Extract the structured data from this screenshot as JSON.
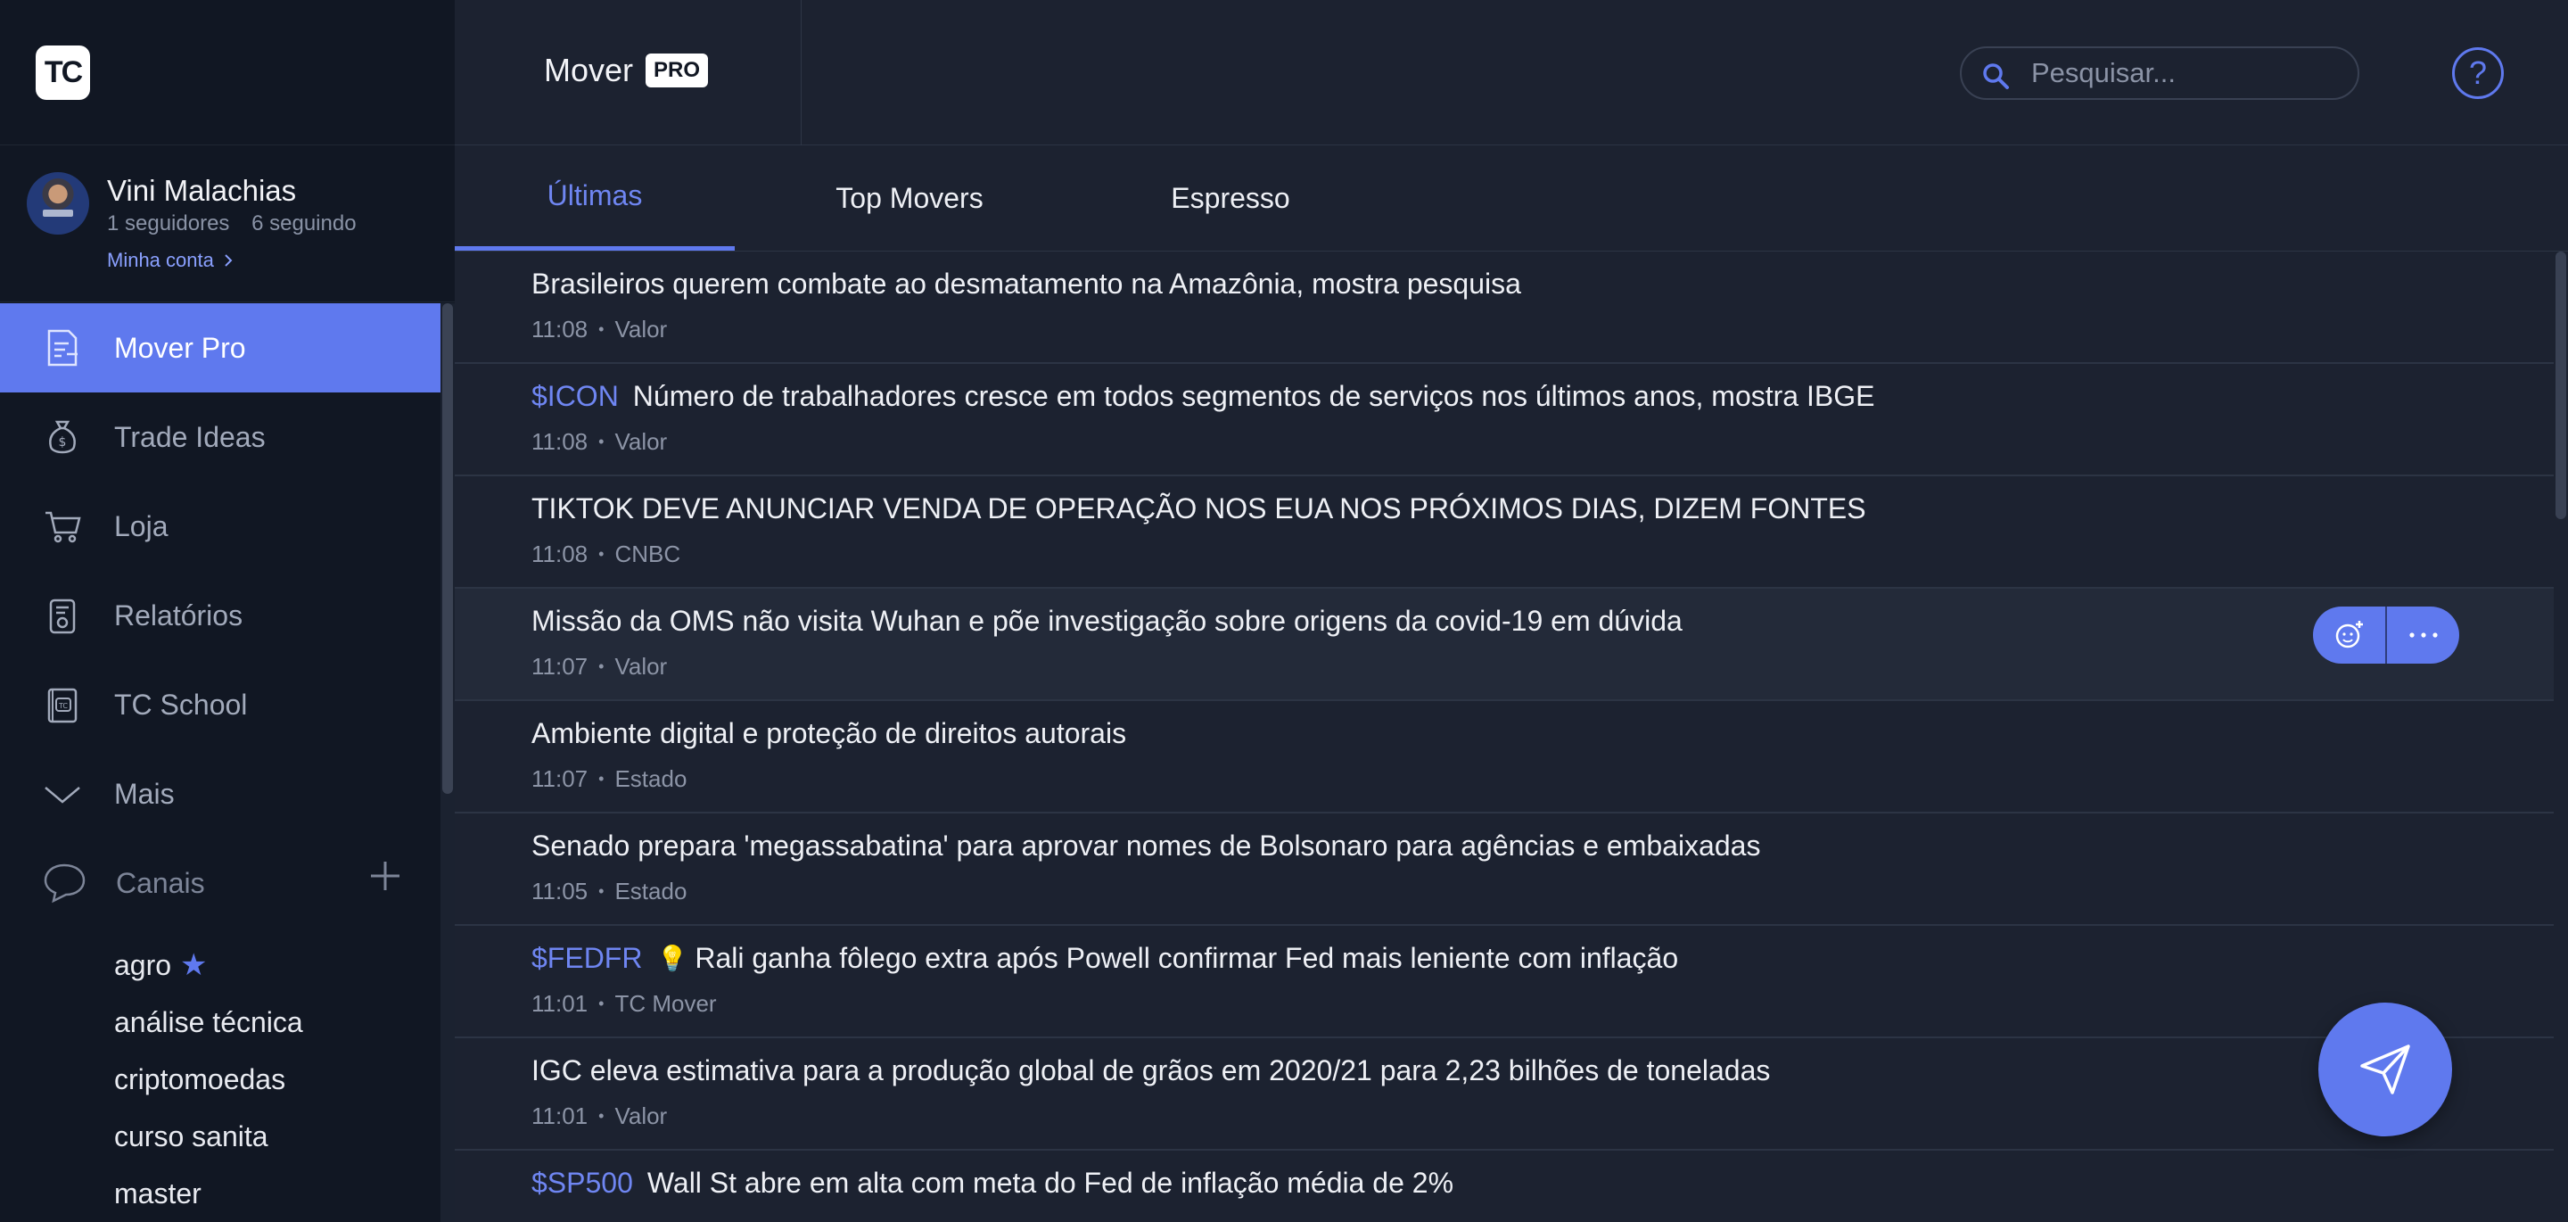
{
  "app": {
    "logo_text": "TC"
  },
  "profile": {
    "name": "Vini Malachias",
    "followers": "1 seguidores",
    "following": "6 seguindo",
    "account_link": "Minha conta"
  },
  "nav": {
    "items": [
      {
        "label": "Mover Pro",
        "icon": "document-icon",
        "active": true
      },
      {
        "label": "Trade Ideas",
        "icon": "money-bag-icon",
        "active": false
      },
      {
        "label": "Loja",
        "icon": "cart-icon",
        "active": false
      },
      {
        "label": "Relatórios",
        "icon": "report-icon",
        "active": false
      },
      {
        "label": "TC School",
        "icon": "school-book-icon",
        "active": false
      },
      {
        "label": "Mais",
        "icon": "chevron-down-icon",
        "active": false
      }
    ]
  },
  "channels": {
    "label": "Canais",
    "items": [
      {
        "name": "agro",
        "starred": true
      },
      {
        "name": "análise técnica",
        "starred": false
      },
      {
        "name": "criptomoedas",
        "starred": false
      },
      {
        "name": "curso sanita",
        "starred": false
      },
      {
        "name": "master",
        "starred": false
      }
    ]
  },
  "header": {
    "title": "Mover",
    "badge": "PRO",
    "search_placeholder": "Pesquisar...",
    "help": "?"
  },
  "tabs": [
    {
      "label": "Últimas",
      "active": true
    },
    {
      "label": "Top Movers",
      "active": false
    },
    {
      "label": "Espresso",
      "active": false
    }
  ],
  "feed": [
    {
      "ticker": "",
      "headline": "Brasileiros querem combate ao desmatamento na Amazônia, mostra pesquisa",
      "time": "11:08",
      "source": "Valor"
    },
    {
      "ticker": "$ICON",
      "headline": "Número de trabalhadores cresce em todos segmentos de serviços nos últimos anos, mostra IBGE",
      "time": "11:08",
      "source": "Valor"
    },
    {
      "ticker": "",
      "headline": "TIKTOK DEVE ANUNCIAR VENDA DE OPERAÇÃO NOS EUA NOS PRÓXIMOS DIAS, DIZEM FONTES",
      "time": "11:08",
      "source": "CNBC"
    },
    {
      "ticker": "",
      "headline": "Missão da OMS não visita Wuhan e põe investigação sobre origens da covid-19 em dúvida",
      "time": "11:07",
      "source": "Valor"
    },
    {
      "ticker": "",
      "headline": "Ambiente digital e proteção de direitos autorais",
      "time": "11:07",
      "source": "Estado"
    },
    {
      "ticker": "",
      "headline": "Senado prepara 'megassabatina' para aprovar nomes de Bolsonaro para agências e embaixadas",
      "time": "11:05",
      "source": "Estado"
    },
    {
      "ticker": "$FEDFR",
      "headline": "Rali ganha fôlego extra após Powell confirmar Fed mais leniente com inflação",
      "time": "11:01",
      "source": "TC Mover"
    },
    {
      "ticker": "",
      "headline": "IGC eleva estimativa para a produção global de grãos em 2020/21 para 2,23 bilhões de toneladas",
      "time": "11:01",
      "source": "Valor"
    },
    {
      "ticker": "$SP500",
      "headline": "Wall St abre em alta com meta do Fed de inflação média de 2%",
      "time": "",
      "source": ""
    }
  ],
  "colors": {
    "accent": "#5f79ee",
    "sidebar_bg": "#111723",
    "main_bg": "#1c2230"
  }
}
